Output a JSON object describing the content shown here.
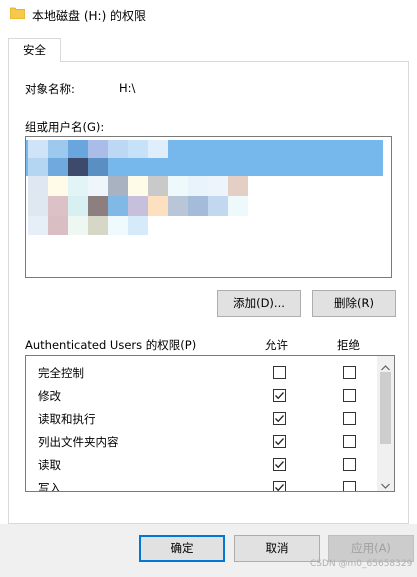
{
  "window": {
    "title": "本地磁盘 (H:) 的权限"
  },
  "tabs": [
    {
      "label": "安全",
      "active": true
    }
  ],
  "object": {
    "label": "对象名称:",
    "value": "H:\\"
  },
  "groups": {
    "label": "组或用户名(G):"
  },
  "buttons": {
    "add": "添加(D)...",
    "remove": "删除(R)",
    "ok": "确定",
    "cancel": "取消",
    "apply": "应用(A)"
  },
  "permissions": {
    "header": "Authenticated Users 的权限(P)",
    "allow_header": "允许",
    "deny_header": "拒绝",
    "rows": [
      {
        "name": "完全控制",
        "allow": false,
        "deny": false
      },
      {
        "name": "修改",
        "allow": true,
        "deny": false
      },
      {
        "name": "读取和执行",
        "allow": true,
        "deny": false
      },
      {
        "name": "列出文件夹内容",
        "allow": true,
        "deny": false
      },
      {
        "name": "读取",
        "allow": true,
        "deny": false
      },
      {
        "name": "写入",
        "allow": true,
        "deny": false
      }
    ]
  },
  "watermark": "CSDN @m0_65658329",
  "colors": {
    "selection": "#76b8ec",
    "focus_border": "#0078d7",
    "folder": "#f6c94a"
  },
  "icons": {
    "title": "folder-icon",
    "scroll_up": "chevron-up-icon",
    "scroll_down": "chevron-down-icon"
  }
}
